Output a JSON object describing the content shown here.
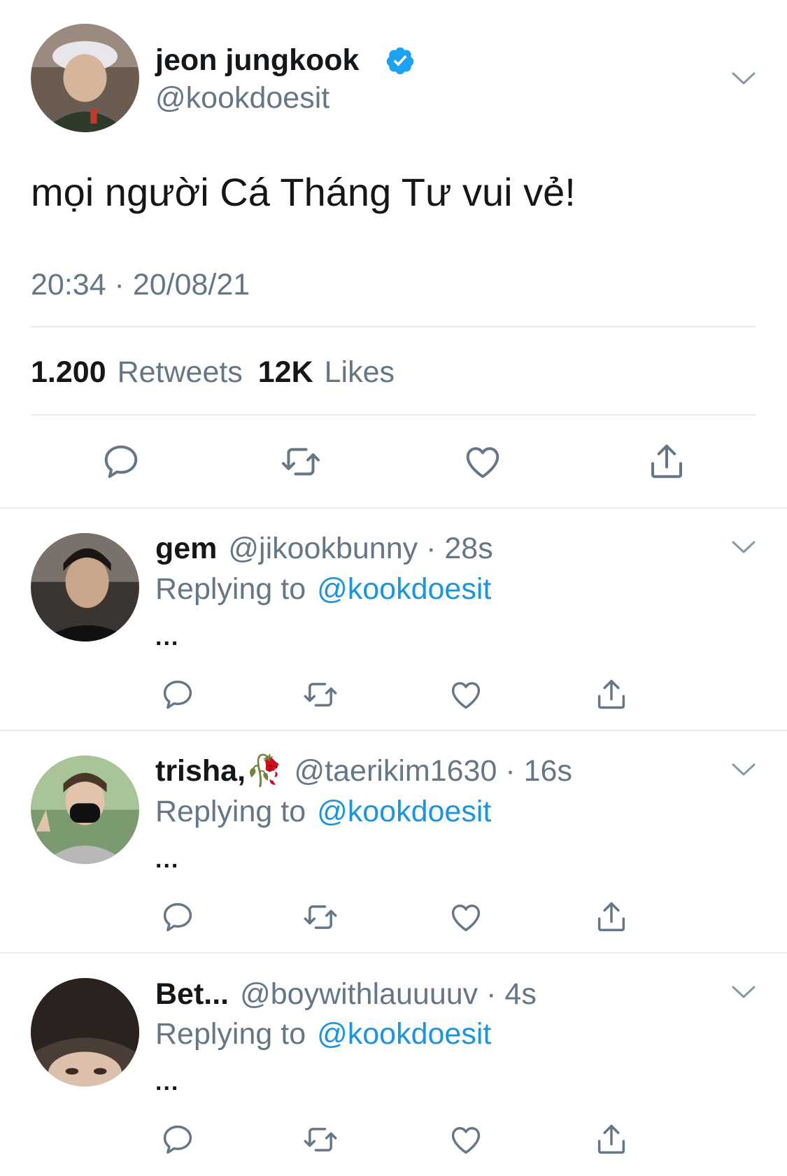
{
  "tweet": {
    "display_name": "jeon jungkook",
    "handle": "@kookdoesit",
    "verified": true,
    "text": "mọi người Cá Tháng Tư vui vẻ!",
    "timestamp": "20:34 · 20/08/21",
    "retweets_count": "1.200",
    "retweets_label": "Retweets",
    "likes_count": "12K",
    "likes_label": "Likes",
    "actions": [
      "reply-icon",
      "retweet-icon",
      "like-icon",
      "share-icon"
    ]
  },
  "replies": [
    {
      "name": "gem",
      "handle": "@jikookbunny",
      "sep": "·",
      "time": "28s",
      "replying_prefix": "Replying to",
      "replying_handle": "@kookdoesit",
      "text": "..."
    },
    {
      "name": "trisha,🥀",
      "handle": "@taerikim1630",
      "sep": "·",
      "time": "16s",
      "replying_prefix": "Replying to",
      "replying_handle": "@kookdoesit",
      "text": "..."
    },
    {
      "name": "Bet...",
      "handle": "@boywithlauuuuv",
      "sep": "·",
      "time": "4s",
      "replying_prefix": "Replying to",
      "replying_handle": "@kookdoesit",
      "text": "..."
    }
  ],
  "colors": {
    "link": "#1b95e0",
    "secondary": "#657786",
    "verified": "#1da1f2",
    "divider": "#e6ecf0"
  }
}
